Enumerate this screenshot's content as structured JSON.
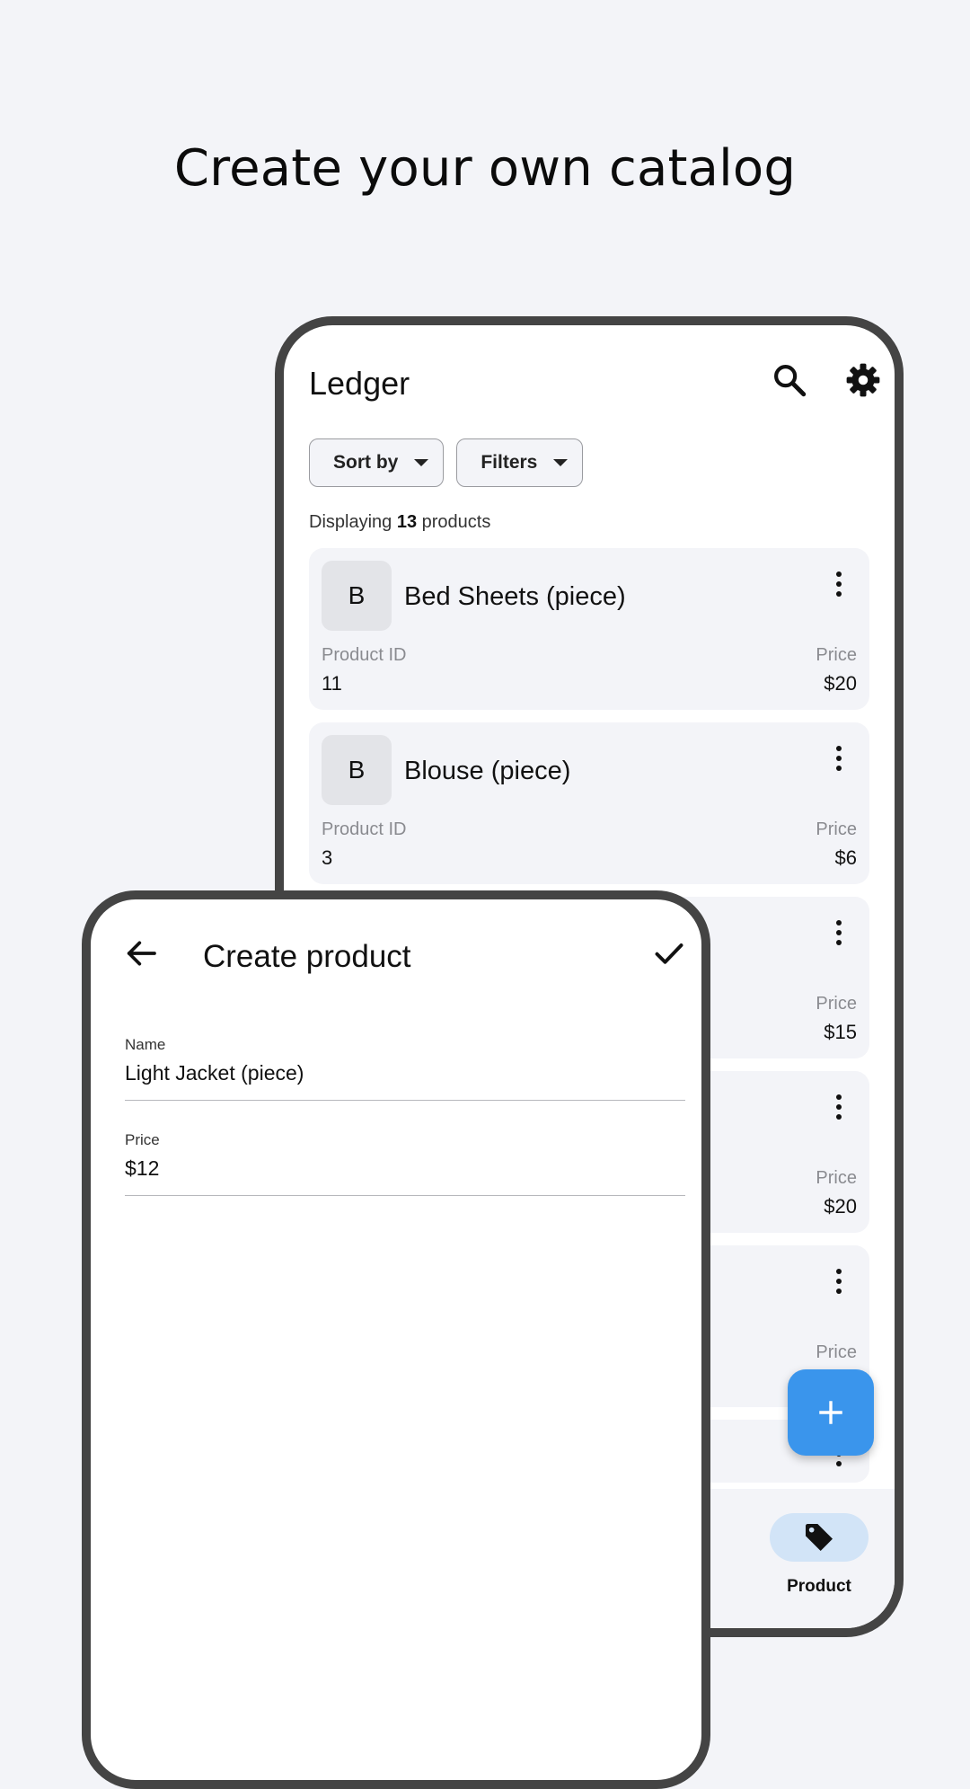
{
  "headline": "Create your own catalog",
  "ledger": {
    "title": "Ledger",
    "icons": {
      "search": "search-icon",
      "settings": "gear-icon"
    },
    "sort_label": "Sort by",
    "filters_label": "Filters",
    "count_prefix": "Displaying",
    "count_value": "13",
    "count_suffix": "products",
    "products": [
      {
        "initial": "B",
        "name": "Bed Sheets (piece)",
        "id_label": "Product ID",
        "id": "11",
        "price_label": "Price",
        "price": "$20"
      },
      {
        "initial": "B",
        "name": "Blouse (piece)",
        "id_label": "Product ID",
        "id": "3",
        "price_label": "Price",
        "price": "$6"
      },
      {
        "initial": "",
        "name": "",
        "id_label": "",
        "id": "",
        "price_label": "Price",
        "price": "$15"
      },
      {
        "initial": "",
        "name": "",
        "id_label": "",
        "id": "",
        "price_label": "Price",
        "price": "$20"
      },
      {
        "initial": "",
        "name": "",
        "id_label": "",
        "id": "",
        "price_label": "Price",
        "price": ""
      }
    ],
    "nav_label": "Product",
    "colors": {
      "accent": "#3a95ec",
      "nav_pill": "#d2e4f7",
      "card_bg": "#f3f4f8"
    }
  },
  "create_product": {
    "title": "Create product",
    "name_label": "Name",
    "name_value": "Light Jacket (piece)",
    "price_label": "Price",
    "price_value": "$12"
  }
}
